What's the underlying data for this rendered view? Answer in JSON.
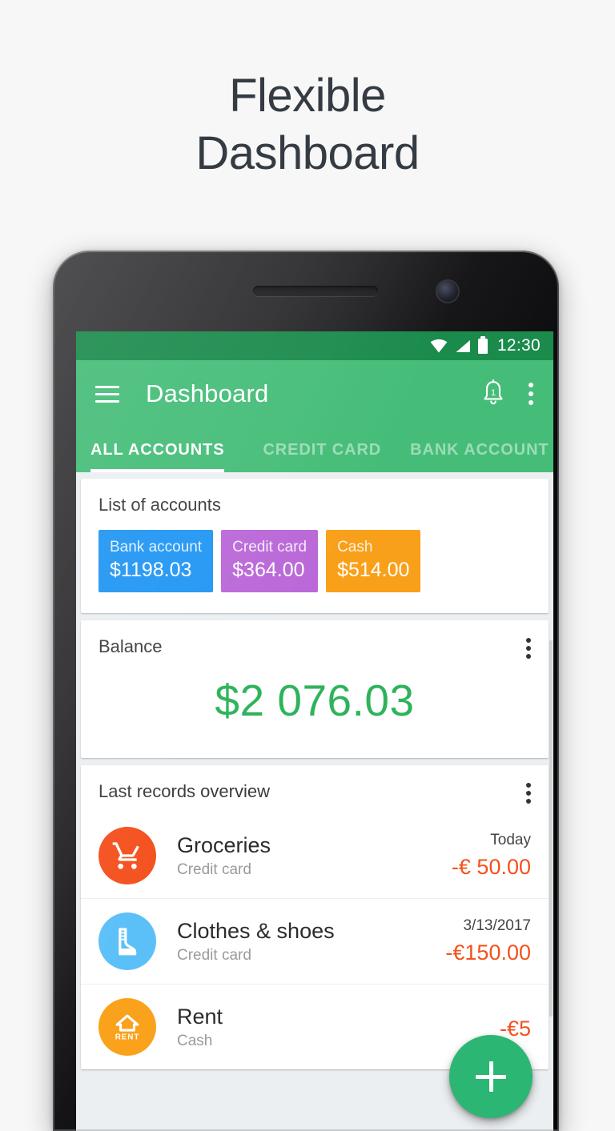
{
  "promo": {
    "line1": "Flexible",
    "line2": "Dashboard"
  },
  "theme": {
    "status_bar_green": "#1b8b4c",
    "app_bar_green": "#45bd78",
    "fab_green": "#2bb673",
    "balance_green": "#2eb35b",
    "expense_red": "#f4511e",
    "page_background": "#f7f7f7"
  },
  "status_bar": {
    "time": "12:30",
    "icons": [
      "wifi-icon",
      "signal-icon",
      "battery-icon"
    ]
  },
  "app_bar": {
    "menu_icon": "hamburger-menu-icon",
    "title": "Dashboard",
    "notification_icon": "notification-bell-icon",
    "notification_badge": "1",
    "overflow_icon": "overflow-menu-icon"
  },
  "tabs": [
    {
      "label": "ALL ACCOUNTS",
      "active": true
    },
    {
      "label": "CREDIT CARD",
      "active": false
    },
    {
      "label": "BANK ACCOUNT",
      "active": false
    }
  ],
  "accounts_card": {
    "title": "List of accounts",
    "chips": [
      {
        "name": "Bank account",
        "amount": "$1198.03",
        "color": "#2196f3"
      },
      {
        "name": "Credit card",
        "amount": "$364.00",
        "color": "#ba68d8"
      },
      {
        "name": "Cash",
        "amount": "$514.00",
        "color": "#f9a01b"
      }
    ]
  },
  "balance_card": {
    "title": "Balance",
    "value": "$2 076.03",
    "overflow_icon": "overflow-menu-icon"
  },
  "records_card": {
    "title": "Last records overview",
    "overflow_icon": "overflow-menu-icon",
    "rows": [
      {
        "title": "Groceries",
        "account": "Credit card",
        "date": "Today",
        "amount": "-€ 50.00",
        "icon": "shopping-cart-icon",
        "icon_color": "#f4511e"
      },
      {
        "title": "Clothes & shoes",
        "account": "Credit card",
        "date": "3/13/2017",
        "amount": "-€150.00",
        "icon": "boot-icon",
        "icon_color": "#5bc0f8"
      },
      {
        "title": "Rent",
        "account": "Cash",
        "date": "",
        "amount": "-€5",
        "icon": "rent-house-icon",
        "icon_label": "RENT",
        "icon_color": "#faa21b"
      }
    ]
  },
  "fab": {
    "icon": "plus-icon",
    "label": "+"
  }
}
